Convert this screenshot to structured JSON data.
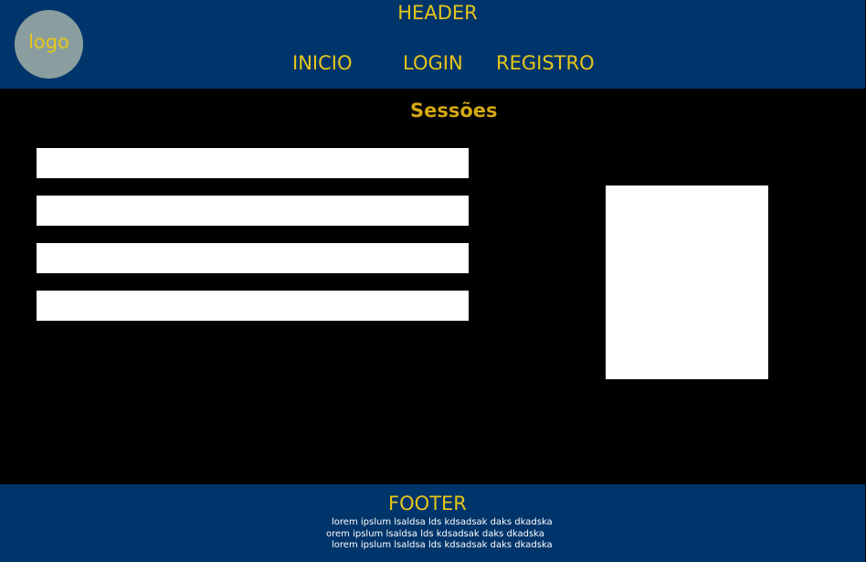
{
  "header": {
    "logo_text": "logo",
    "title": "HEADER",
    "nav": [
      {
        "label": "INICIO"
      },
      {
        "label": "LOGIN"
      },
      {
        "label": "REGISTRO"
      }
    ]
  },
  "main": {
    "section_title": "Sessões",
    "session_count": 4
  },
  "footer": {
    "title": "FOOTER",
    "lines": [
      "lorem ipslum lsaldsa lds kdsadsak daks dkadska",
      "orem ipslum lsaldsa lds kdsadsak daks dkadska",
      "lorem ipslum lsaldsa lds kdsadsak daks dkadska"
    ]
  },
  "colors": {
    "header_bg": "#00356b",
    "accent_text": "#e6c619",
    "section_title": "#d4a714",
    "logo_circle": "#8a9ea0",
    "content_bg": "#000000"
  }
}
